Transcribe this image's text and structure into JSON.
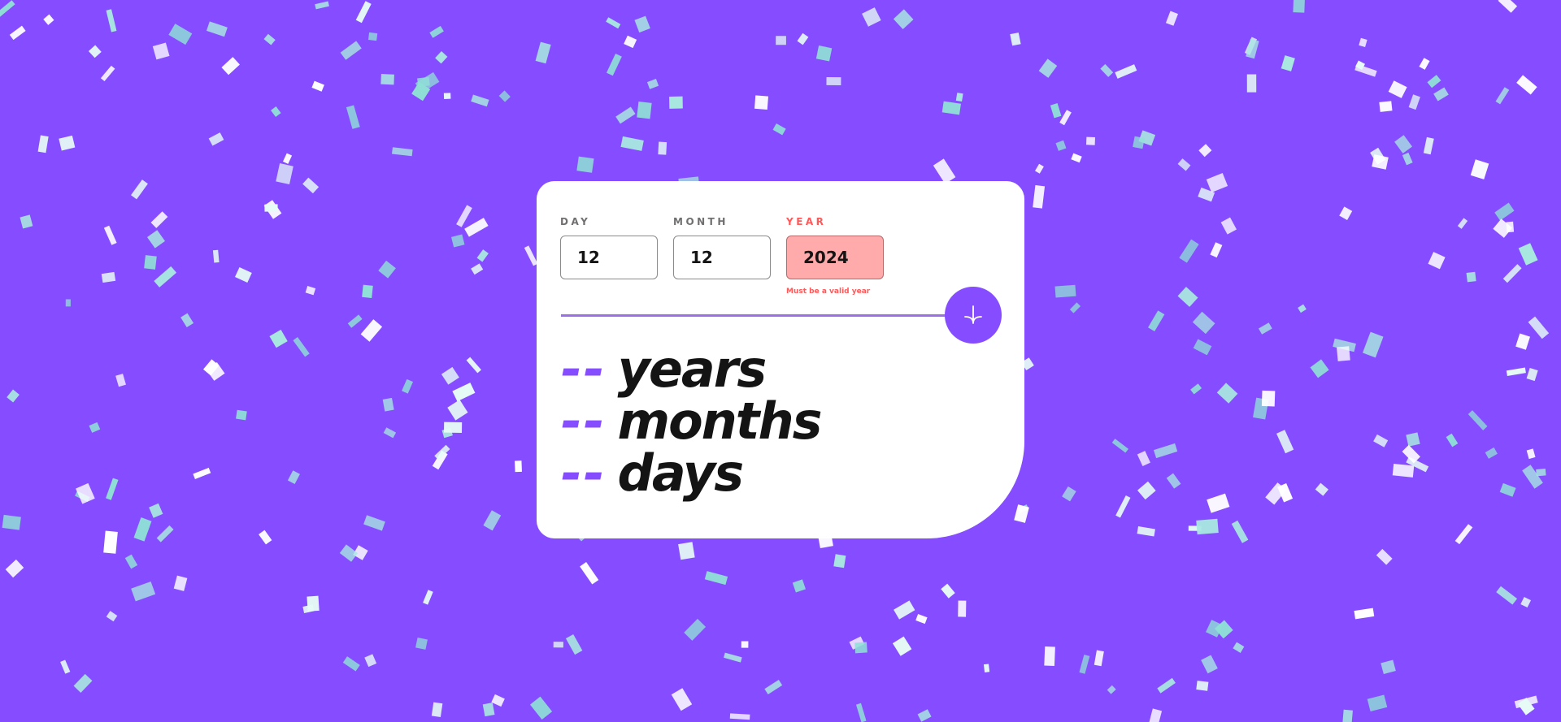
{
  "colors": {
    "background": "#854dff",
    "accent": "#854dff",
    "error": "#ff5959",
    "confetti_light": "#e6fbf5",
    "confetti_teal": "#8fe0d6"
  },
  "form": {
    "day": {
      "label": "DAY",
      "value": "12"
    },
    "month": {
      "label": "MONTH",
      "value": "12"
    },
    "year": {
      "label": "YEAR",
      "value": "2024",
      "error": "Must be a valid year"
    }
  },
  "submit": {
    "icon": "arrow-down-icon"
  },
  "results": [
    {
      "value": "--",
      "unit": "years"
    },
    {
      "value": "--",
      "unit": "months"
    },
    {
      "value": "--",
      "unit": "days"
    }
  ]
}
